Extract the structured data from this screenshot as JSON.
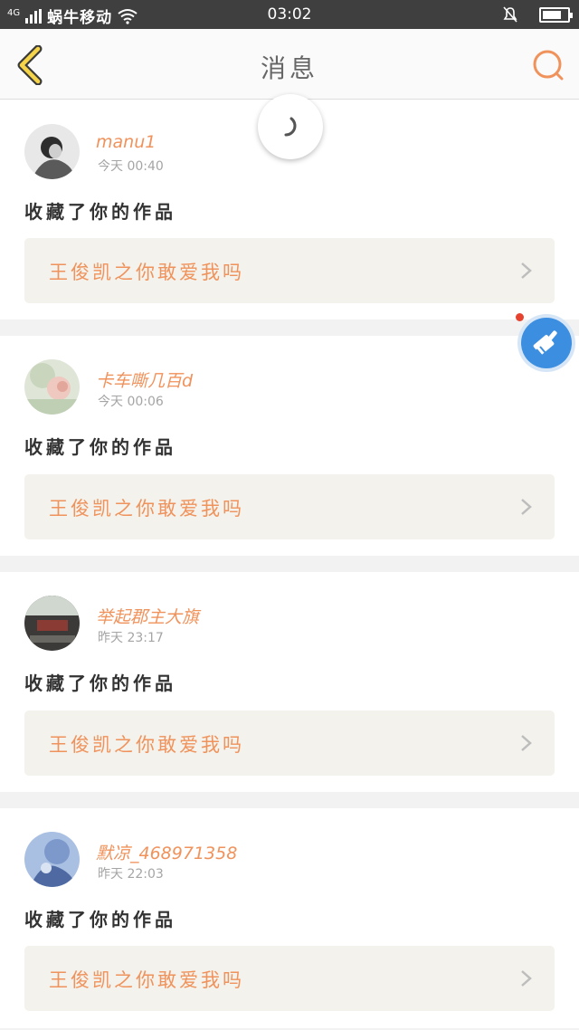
{
  "status_bar": {
    "network": "4G",
    "carrier": "蜗牛移动",
    "time": "03:02",
    "battery_level": 0.75
  },
  "header": {
    "title": "消息",
    "accent": "#f0925b"
  },
  "messages": [
    {
      "username": "manu1",
      "timestamp": "今天 00:40",
      "action": "收藏了你的作品",
      "work_title": "王俊凯之你敢爱我吗"
    },
    {
      "username": "卡车嘶几百d",
      "timestamp": "今天 00:06",
      "action": "收藏了你的作品",
      "work_title": "王俊凯之你敢爱我吗"
    },
    {
      "username": "举起郡主大旗",
      "timestamp": "昨天 23:17",
      "action": "收藏了你的作品",
      "work_title": "王俊凯之你敢爱我吗"
    },
    {
      "username": "默凉_468971358",
      "timestamp": "昨天 22:03",
      "action": "收藏了你的作品",
      "work_title": "王俊凯之你敢爱我吗"
    }
  ],
  "icons": {
    "back": "chevron-left-icon",
    "search": "search-icon",
    "loading": "spinner-icon",
    "assist": "broom-icon",
    "row_arrow": "chevron-right-icon"
  }
}
